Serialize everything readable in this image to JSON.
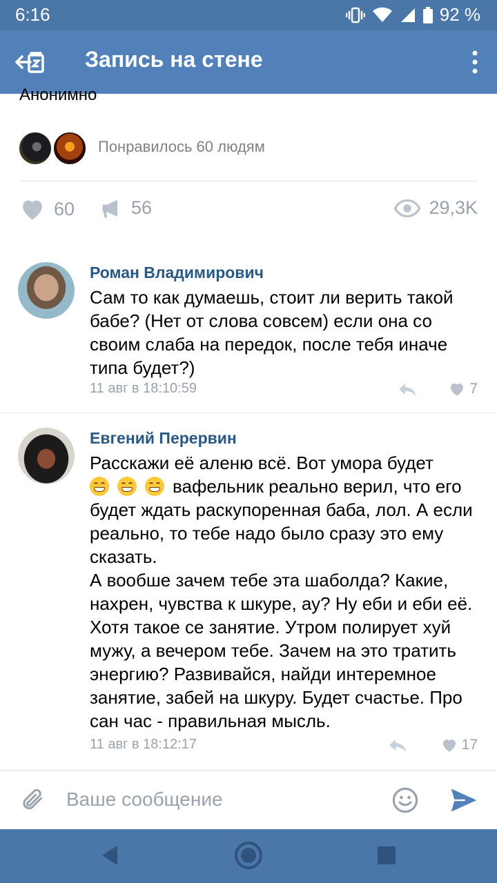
{
  "status_bar": {
    "time": "6:16",
    "battery": "92 %",
    "icons": [
      "vibrate-icon",
      "wifi-icon",
      "signal-icon",
      "battery-icon"
    ]
  },
  "header": {
    "title": "Запись на стене",
    "back_icon": "back-to-wall-icon",
    "menu_icon": "more-vertical-icon"
  },
  "post": {
    "author_partial": "Анонимно",
    "likers_text": "Понравилось 60 людям",
    "likes": "60",
    "reposts": "56",
    "views": "29,3K"
  },
  "comments": [
    {
      "author": "Роман Владимирович",
      "text": "Сам то как думаешь, стоит ли верить такой бабе? (Нет от слова совсем) если она со своим слаба на передок, после тебя иначе типа будет?)",
      "time": "11 авг в 18:10:59",
      "likes": "7"
    },
    {
      "author": "Евгений Перервин",
      "text_line1": "Расскажи её аленю всё. Вот умора будет",
      "text_after_emoji": "вафельник реально верил, что его будет ждать раскупоренная баба, лол. А если реально, то тебе надо было сразу это ему сказать.\nА вообше зачем тебе эта шаболда? Какие, нахрен, чувства к шкуре, ау? Ну еби и еби её. Хотя такое се занятие. Утром полирует хуй мужу, а вечером тебе. Зачем на это тратить энергию? Развивайся, найди интеремное занятие, забей на шкуру. Будет счастье. Про сан час - правильная мысль.",
      "emoji": [
        "grinning-face",
        "grinning-face",
        "grinning-face"
      ],
      "time": "11 авг в 18:12:17",
      "likes": "17"
    }
  ],
  "composer": {
    "placeholder": "Ваше сообщение"
  },
  "colors": {
    "header": "#5181b8",
    "status_bar": "#4a76a8",
    "link": "#2a5885",
    "muted": "#99a2ad"
  }
}
